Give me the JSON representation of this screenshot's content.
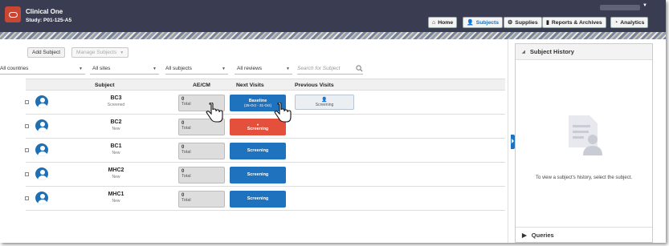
{
  "header": {
    "app_title": "Clinical One",
    "study": "Study: P01-125-A5",
    "nav": [
      {
        "label": "Home",
        "icon": "home-icon"
      },
      {
        "label": "Subjects",
        "icon": "person-icon",
        "active": true
      },
      {
        "label": "Supplies",
        "icon": "supplies-icon"
      },
      {
        "label": "Reports & Archives",
        "icon": "bar-chart-icon"
      },
      {
        "label": "Analytics",
        "icon": "gauge-icon"
      }
    ]
  },
  "toolbar": {
    "add_subject": "Add Subject",
    "manage_subjects": "Manage Subjects"
  },
  "filters": {
    "countries": "All countries",
    "sites": "All sites",
    "subjects": "All subjects",
    "reviews": "All reviews",
    "search_placeholder": "Search for Subject"
  },
  "table": {
    "headers": {
      "subject": "Subject",
      "aecm": "AE/CM",
      "next_visits": "Next Visits",
      "previous_visits": "Previous Visits"
    },
    "rows": [
      {
        "id": "BC3",
        "status": "Screened",
        "aecm_count": "0",
        "aecm_label": "Total",
        "next_visit": "Baseline",
        "next_visit_sub": "(25-Oct - 31-Oct)",
        "next_color": "blue",
        "previous": "Screening"
      },
      {
        "id": "BC2",
        "status": "New",
        "aecm_count": "0",
        "aecm_label": "Total",
        "next_visit": "Screening",
        "next_visit_sub": "",
        "next_color": "red",
        "previous": ""
      },
      {
        "id": "BC1",
        "status": "New",
        "aecm_count": "0",
        "aecm_label": "Total",
        "next_visit": "Screening",
        "next_visit_sub": "",
        "next_color": "blue",
        "previous": ""
      },
      {
        "id": "MHC2",
        "status": "New",
        "aecm_count": "0",
        "aecm_label": "Total",
        "next_visit": "Screening",
        "next_visit_sub": "",
        "next_color": "blue",
        "previous": ""
      },
      {
        "id": "MHC1",
        "status": "New",
        "aecm_count": "0",
        "aecm_label": "Total",
        "next_visit": "Screening",
        "next_visit_sub": "",
        "next_color": "blue",
        "previous": ""
      }
    ]
  },
  "side_panel": {
    "title": "Subject History",
    "message": "To view a subject's history, select the subject.",
    "footer": "Queries"
  },
  "colors": {
    "accent": "#1f73be",
    "alert": "#e5503c",
    "header": "#3a3d52",
    "logo": "#c74634"
  }
}
